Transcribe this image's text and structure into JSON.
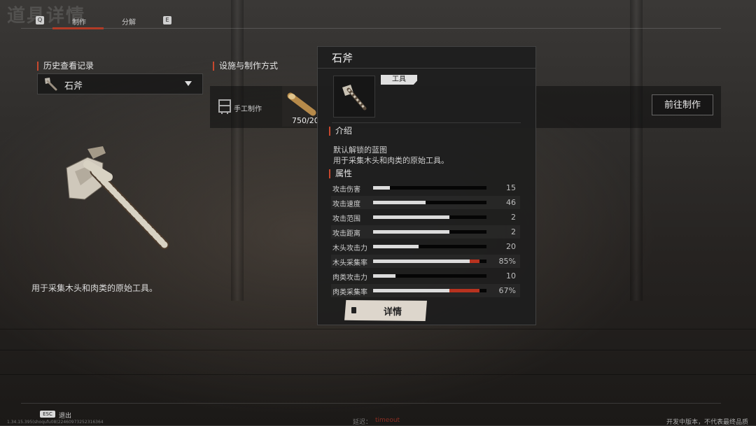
{
  "page_title": "道具详情",
  "tabs": {
    "left_key": "Q",
    "items": [
      {
        "label": "制作",
        "active": true
      },
      {
        "label": "分解",
        "active": false
      }
    ],
    "right_key": "E"
  },
  "history": {
    "header": "历史查看记录",
    "selected": "石斧"
  },
  "crafting": {
    "header": "设施与制作方式",
    "method_label": "手工制作",
    "material_count": "750/20",
    "go_button": "前往制作"
  },
  "item_description": "用于采集木头和肉类的原始工具。",
  "panel": {
    "title": "石斧",
    "type_tag": "工具",
    "intro_header": "介绍",
    "intro_lines": [
      "默认解锁的蓝图",
      "用于采集木头和肉类的原始工具。"
    ],
    "attr_header": "属性",
    "stats": [
      {
        "label": "攻击伤害",
        "value": "15",
        "white": 0.15,
        "red": 0
      },
      {
        "label": "攻击速度",
        "value": "46",
        "white": 0.46,
        "red": 0
      },
      {
        "label": "攻击范围",
        "value": "2",
        "white": 0.67,
        "red": 0
      },
      {
        "label": "攻击距离",
        "value": "2",
        "white": 0.67,
        "red": 0
      },
      {
        "label": "木头攻击力",
        "value": "20",
        "white": 0.4,
        "red": 0
      },
      {
        "label": "木头采集率",
        "value": "85%",
        "white": 0.85,
        "red": 0.085
      },
      {
        "label": "肉类攻击力",
        "value": "10",
        "white": 0.2,
        "red": 0
      },
      {
        "label": "肉类采集率",
        "value": "67%",
        "white": 0.67,
        "red": 0.265
      }
    ],
    "detail_button": "详情"
  },
  "footer": {
    "esc_key": "ESC",
    "exit_label": "退出",
    "version": "1.34.15.395(shoqufu08(22460973252316364",
    "latency_label": "延迟：",
    "latency_value": "timeout",
    "dev_notice": "开发中版本，不代表最终品质"
  },
  "colors": {
    "accent": "#c8482e",
    "red_bar": "#b8321f",
    "latency": "#8a2e22"
  },
  "icons": [
    "stone-axe-icon",
    "workbench-icon",
    "wood-log-icon",
    "dropdown-arrow-icon",
    "book-icon"
  ]
}
